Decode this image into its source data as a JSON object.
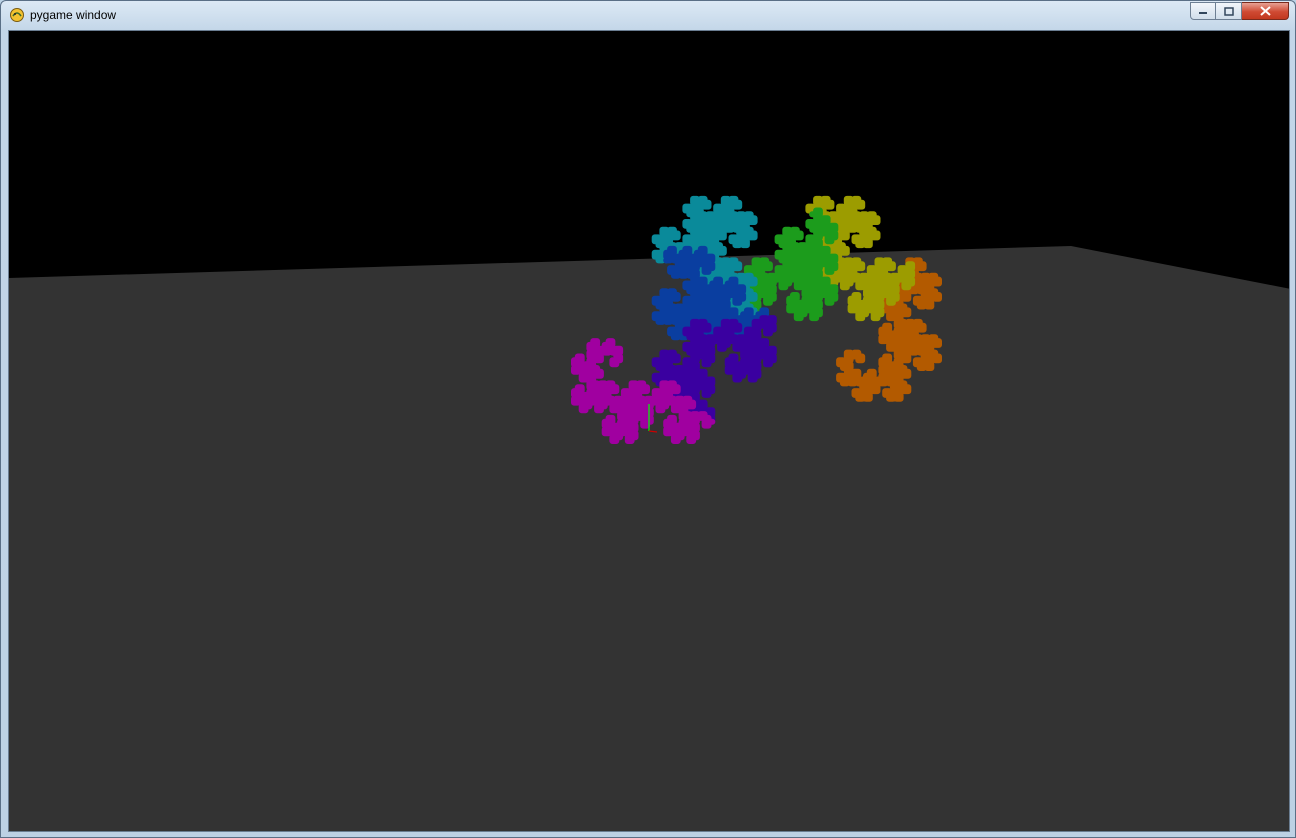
{
  "window": {
    "title": "pygame window",
    "app_icon": "pygame-snake-icon",
    "controls": {
      "minimize_icon": "minimize-icon",
      "maximize_icon": "maximize-icon",
      "close_icon": "close-icon"
    }
  },
  "scene": {
    "background_color": "#000000",
    "floor_color": "#333333",
    "fractal": "dragon-curve",
    "fractal_gradient": [
      "#b35a00",
      "#9c9c00",
      "#1c9c1c",
      "#0a8a9a",
      "#0a3ea0",
      "#3a00a0",
      "#a000a0"
    ],
    "axis_marker_color": "#00ff00"
  }
}
